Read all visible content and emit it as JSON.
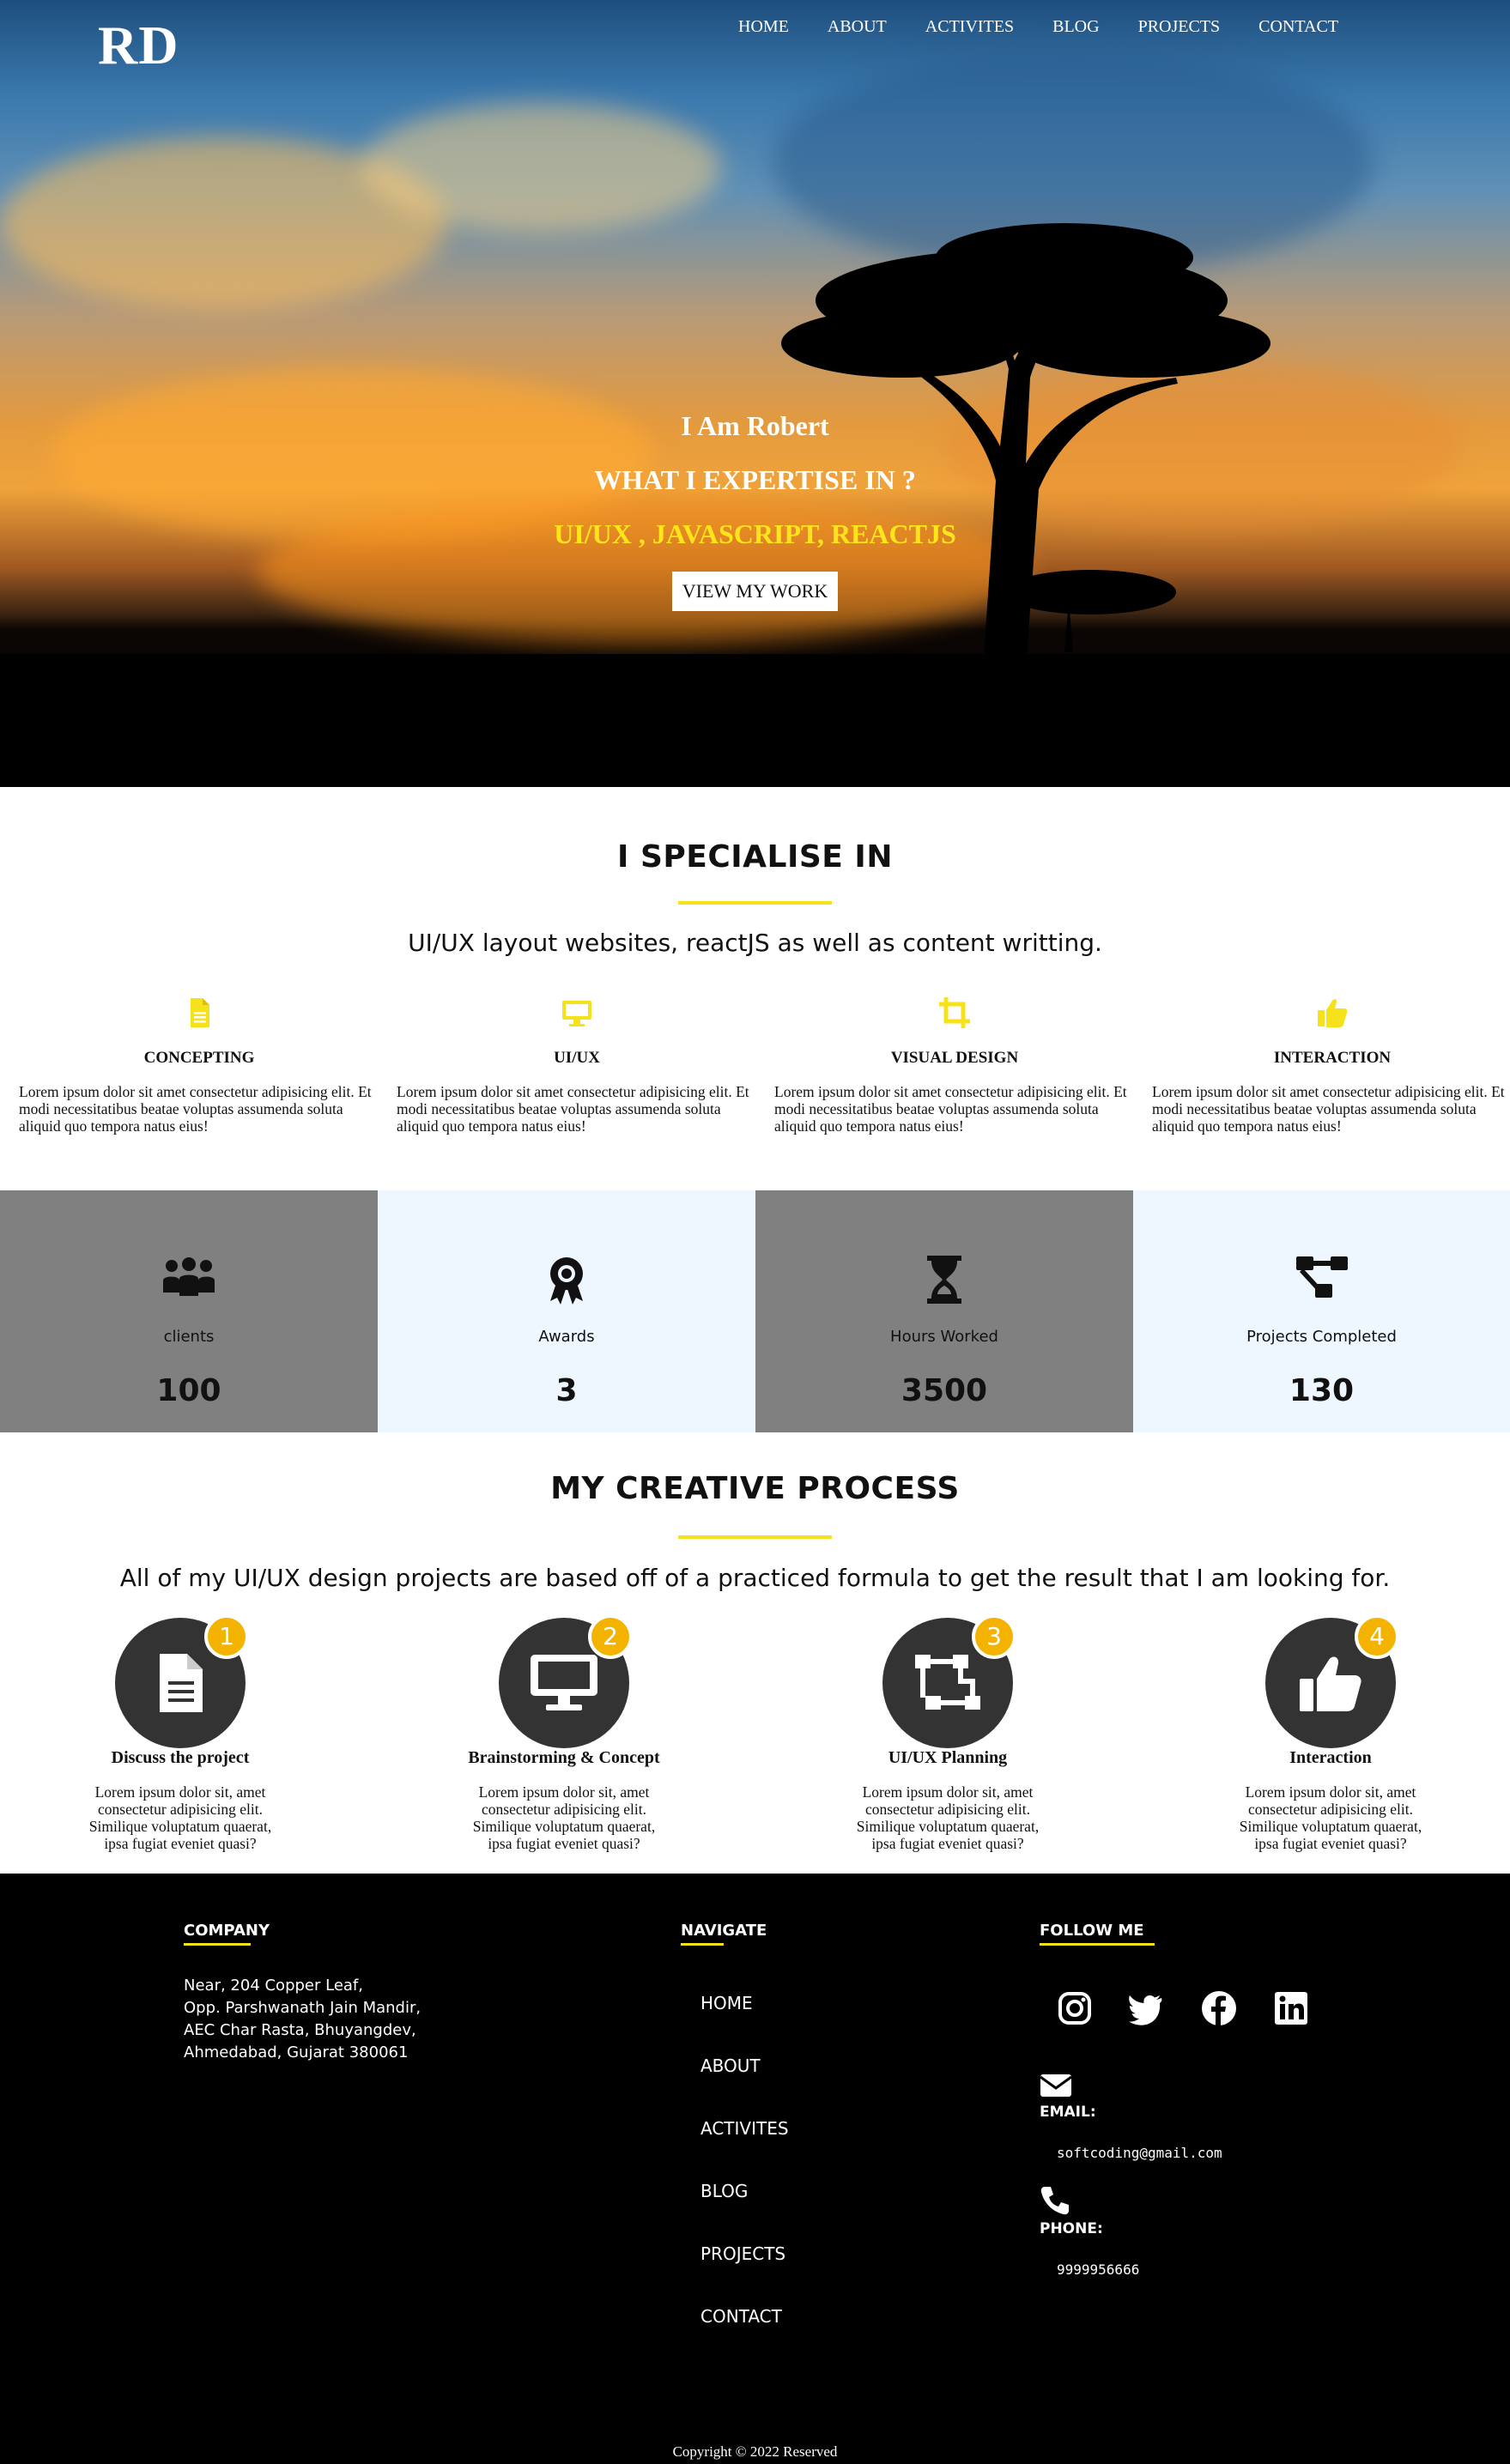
{
  "brand": {
    "logo": "RD"
  },
  "nav": {
    "items": [
      "HOME",
      "ABOUT",
      "ACTIVITES",
      "BLOG",
      "PROJECTS",
      "CONTACT"
    ]
  },
  "hero": {
    "name": "I Am Robert",
    "question": "WHAT I EXPERTISE IN ?",
    "skills": "UI/UX , JAVASCRIPT, REACTJS",
    "button_label": "VIEW MY WORK"
  },
  "specialise": {
    "title": "I SPECIALISE IN",
    "subtitle": "UI/UX layout websites, reactJS as well as content writting.",
    "accent": "#f5e21a",
    "icon_color": "#f5e21a",
    "items": [
      {
        "icon": "file-icon",
        "title": "CONCEPTING",
        "text": "Lorem ipsum dolor sit amet consectetur adipisicing elit. Et modi necessitatibus beatae voluptas assumenda soluta aliquid quo tempora natus eius!"
      },
      {
        "icon": "desktop-icon",
        "title": "UI/UX",
        "text": "Lorem ipsum dolor sit amet consectetur adipisicing elit. Et modi necessitatibus beatae voluptas assumenda soluta aliquid quo tempora natus eius!"
      },
      {
        "icon": "crop-icon",
        "title": "VISUAL DESIGN",
        "text": "Lorem ipsum dolor sit amet consectetur adipisicing elit. Et modi necessitatibus beatae voluptas assumenda soluta aliquid quo tempora natus eius!"
      },
      {
        "icon": "thumbs-up-icon",
        "title": "INTERACTION",
        "text": "Lorem ipsum dolor sit amet consectetur adipisicing elit. Et modi necessitatibus beatae voluptas assumenda soluta aliquid quo tempora natus eius!"
      }
    ]
  },
  "stats": {
    "colors": {
      "dark": "#808080",
      "light": "#eef6ff"
    },
    "items": [
      {
        "icon": "users-icon",
        "label": "clients",
        "value": "100"
      },
      {
        "icon": "award-icon",
        "label": "Awards",
        "value": "3"
      },
      {
        "icon": "hourglass-icon",
        "label": "Hours Worked",
        "value": "3500"
      },
      {
        "icon": "project-diagram-icon",
        "label": "Projects Completed",
        "value": "130"
      }
    ]
  },
  "process": {
    "title": "MY CREATIVE PROCESS",
    "subtitle": "All of my UI/UX design projects are based off of a practiced formula to get the result that I am looking for.",
    "badge_color": "#f4b300",
    "steps": [
      {
        "number": "1",
        "icon": "file-icon",
        "title": "Discuss the project",
        "text": "Lorem ipsum dolor sit, amet consectetur adipisicing elit. Similique voluptatum quaerat, ipsa fugiat eveniet quasi?"
      },
      {
        "number": "2",
        "icon": "desktop-icon",
        "title": "Brainstorming & Concept",
        "text": "Lorem ipsum dolor sit, amet consectetur adipisicing elit. Similique voluptatum quaerat, ipsa fugiat eveniet quasi?"
      },
      {
        "number": "3",
        "icon": "vector-square-icon",
        "title": "UI/UX Planning",
        "text": "Lorem ipsum dolor sit, amet consectetur adipisicing elit. Similique voluptatum quaerat, ipsa fugiat eveniet quasi?"
      },
      {
        "number": "4",
        "icon": "thumbs-up-icon",
        "title": "Interaction",
        "text": "Lorem ipsum dolor sit, amet consectetur adipisicing elit. Similique voluptatum quaerat, ipsa fugiat eveniet quasi?"
      }
    ]
  },
  "footer": {
    "company": {
      "heading": "COMPANY",
      "address": [
        "Near, 204 Copper Leaf,",
        "Opp. Parshwanath Jain Mandir,",
        "AEC Char Rasta, Bhuyangdev,",
        "Ahmedabad, Gujarat 380061"
      ]
    },
    "navigate": {
      "heading": "NAVIGATE",
      "links": [
        "HOME",
        "ABOUT",
        "ACTIVITES",
        "BLOG",
        "PROJECTS",
        "CONTACT"
      ]
    },
    "follow": {
      "heading": "FOLLOW ME",
      "socials": [
        "instagram-icon",
        "twitter-icon",
        "facebook-icon",
        "linkedin-icon"
      ],
      "email_label": "EMAIL:",
      "email": "softcoding@gmail.com",
      "phone_label": "PHONE:",
      "phone": "9999956666"
    },
    "copyright": "Copyright © 2022 Reserved"
  }
}
